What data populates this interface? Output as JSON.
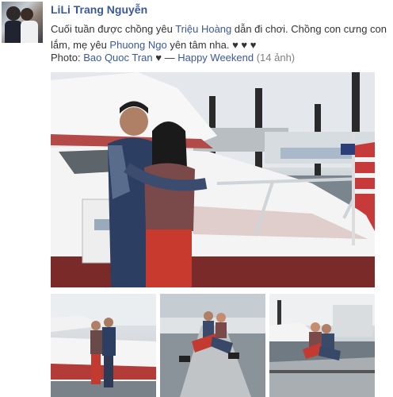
{
  "post": {
    "author": "LiLi Trang Nguyễn",
    "message_parts": [
      {
        "text": "Cuối tuần được chồng yêu ",
        "link": false
      },
      {
        "text": "Triệu Hoàng",
        "link": true
      },
      {
        "text": " dẫn đi chơi. Chồng con cưng con lắm, mẹ yêu ",
        "link": false
      },
      {
        "text": "Phuong Ngo",
        "link": true
      },
      {
        "text": " yên tâm nha. ♥ ♥ ♥",
        "link": false
      }
    ],
    "photo_label": "Photo: ",
    "photographer": "Bao Quoc Tran",
    "album_separator": " ♥ — ",
    "album_name": "Happy Weekend",
    "album_count": " (14 ảnh)"
  },
  "icons": {
    "avatar": "profile-photo",
    "main": "couple-on-yacht-photo",
    "small": [
      "couple-standing-by-boat-photo",
      "couple-sitting-on-pier-photo",
      "couple-sitting-on-dock-photo"
    ]
  },
  "colors": {
    "link": "#3b5998",
    "text": "#333333",
    "muted": "#808080"
  }
}
